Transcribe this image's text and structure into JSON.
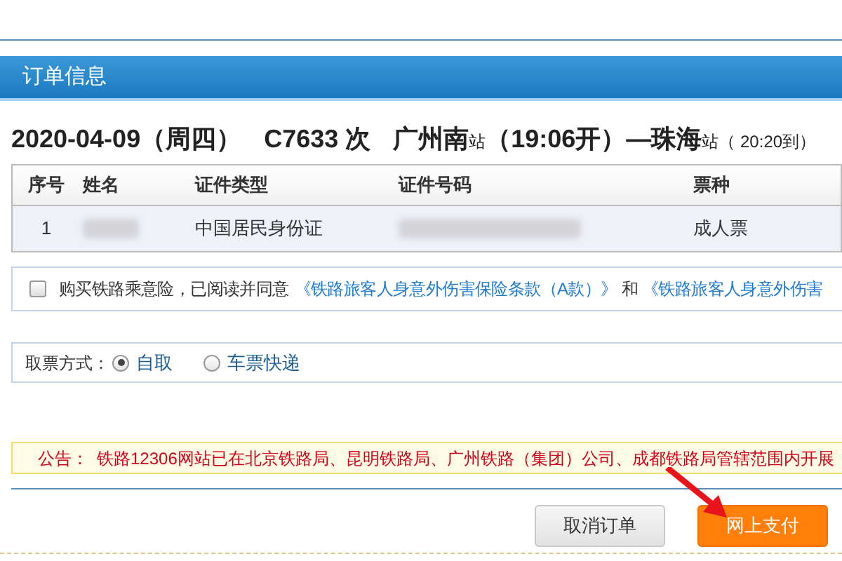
{
  "section_title": "订单信息",
  "trip": {
    "date": "2020-04-09（周四）",
    "train": "C7633 次",
    "from": "广州南",
    "from_suffix": "站",
    "depart": "（19:06开）—",
    "to": "珠海",
    "to_suffix": "站",
    "arrive": "（ 20:20到）"
  },
  "table": {
    "columns": [
      "序号",
      "姓名",
      "证件类型",
      "证件号码",
      "票种"
    ],
    "rows": [
      {
        "cells": [
          {
            "kind": "text",
            "text": "1"
          },
          {
            "kind": "blurred"
          },
          {
            "kind": "text",
            "text": "中国居民身份证"
          },
          {
            "kind": "blurred"
          },
          {
            "kind": "text",
            "text": "成人票"
          }
        ]
      }
    ]
  },
  "insurance": {
    "checked": false,
    "label": "购买铁路乘意险，已阅读并同意",
    "link1": "《铁路旅客人身意外伤害保险条款（A款）》",
    "joiner": "和",
    "link2": "《铁路旅客人身意外伤害"
  },
  "pickup": {
    "label": "取票方式：",
    "options": [
      {
        "label": "自取",
        "selected": true
      },
      {
        "label": "车票快递",
        "selected": false
      }
    ]
  },
  "notice": {
    "label": "公告：",
    "text": "铁路12306网站已在北京铁路局、昆明铁路局、广州铁路（集团）公司、成都铁路局管辖范围内开展"
  },
  "buttons": [
    {
      "kind": "secondary",
      "label": "取消订单"
    },
    {
      "kind": "primary",
      "label": "网上支付"
    }
  ]
}
